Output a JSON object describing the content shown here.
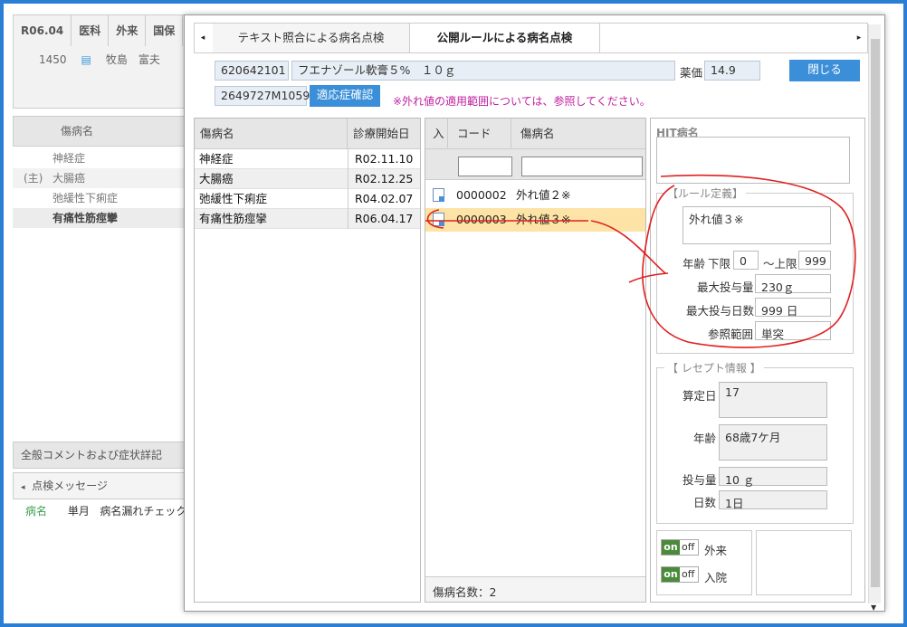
{
  "background": {
    "header": {
      "date": "R06.04",
      "dept": "医科",
      "visit_type": "外来",
      "insurance": "国保",
      "patient_no": "1450",
      "patient_name": "牧島　富夫"
    },
    "disease_header": "傷病名",
    "diseases": [
      {
        "prefix": "",
        "name": "神経症"
      },
      {
        "prefix": "(主)",
        "name": "大腸癌"
      },
      {
        "prefix": "",
        "name": "弛緩性下痢症"
      },
      {
        "prefix": "",
        "name": "有痛性筋痙攣"
      }
    ],
    "comment_section": "全般コメントおよび症状詳記",
    "check_tab": "点検メッセージ",
    "check_row": {
      "type": "病名",
      "period": "単月",
      "message": "病名漏れチェック"
    }
  },
  "dialog": {
    "tabs": [
      {
        "label": "テキスト照合による病名点検"
      },
      {
        "label": "公開ルールによる病名点検"
      }
    ],
    "drug_code": "620642101",
    "drug_name": "フエナゾール軟膏５%　１０ｇ",
    "price_label": "薬価",
    "price_value": "14.9",
    "close_label": "閉じる",
    "rule_code": "2649727M1059",
    "indication_btn": "適応症確認",
    "note": "※外れ値の適用範囲については、参照してください。",
    "left_table": {
      "headers": [
        "傷病名",
        "診療開始日"
      ],
      "rows": [
        {
          "name": "神経症",
          "date": "R02.11.10"
        },
        {
          "name": "大腸癌",
          "date": "R02.12.25"
        },
        {
          "name": "弛緩性下痢症",
          "date": "R04.02.07"
        },
        {
          "name": "有痛性筋痙攣",
          "date": "R06.04.17"
        }
      ]
    },
    "rule_table": {
      "headers": [
        "入",
        "コード",
        "傷病名"
      ],
      "rows": [
        {
          "code": "0000002",
          "name": "外れ値２※"
        },
        {
          "code": "0000003",
          "name": "外れ値３※"
        }
      ],
      "count_text": "傷病名数：2"
    },
    "hit_label": "HIT病名",
    "rule_def": {
      "title": "【ルール定義】",
      "name": "外れ値３※",
      "age_label": "年齢",
      "lower_label": "下限",
      "lower_value": "0",
      "upper_label": "〜上限",
      "upper_value": "999",
      "max_dose_label": "最大投与量",
      "max_dose_value": "230ｇ",
      "max_days_label": "最大投与日数",
      "max_days_value": "999 日",
      "ref_label": "参照範囲",
      "ref_value": "単突"
    },
    "receipt": {
      "title": "【 レセプト情報 】",
      "calc_day_label": "算定日",
      "calc_day_value": "17",
      "age_label": "年齢",
      "age_value": "68歳7ケ月",
      "dose_label": "投与量",
      "dose_value": "10 ｇ",
      "days_label": "日数",
      "days_value": "1日"
    },
    "toggles": [
      {
        "on": "on",
        "off": "off",
        "label": "外来"
      },
      {
        "on": "on",
        "off": "off",
        "label": "入院"
      }
    ]
  },
  "colors": {
    "accent": "#3b8fd8",
    "frame": "#2a7fd4",
    "selected_row": "#fde3a6",
    "annotation": "#e02020",
    "note": "#c020a0"
  }
}
